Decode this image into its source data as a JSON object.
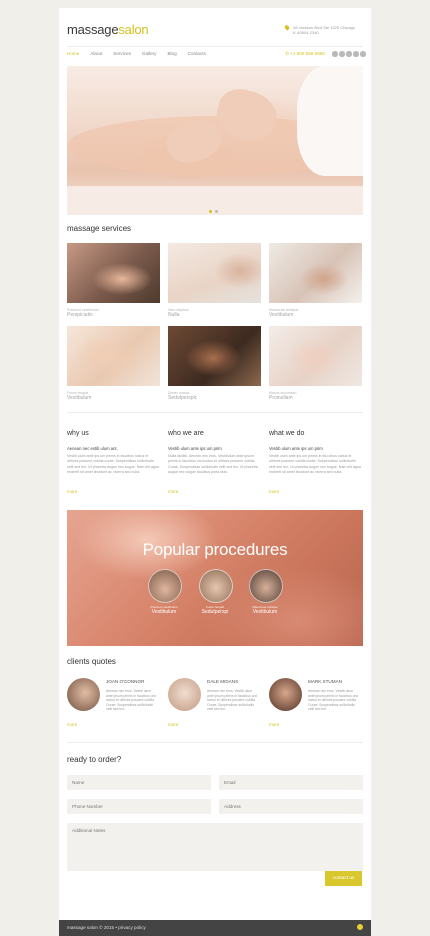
{
  "colors": {
    "accent": "#d4c21f",
    "text": "#333333",
    "muted": "#9a9a9a",
    "footer": "#444444"
  },
  "header": {
    "logo_part1": "massage",
    "logo_part2": "salon",
    "address_line1": "28 Jackson Blvd Ste 1020 Chicago",
    "address_line2": "IL 60604-2340",
    "phone": "+1 800 559 6580",
    "social_icons": [
      "facebook-icon",
      "twitter-icon",
      "google-plus-icon",
      "rss-icon",
      "pinterest-icon"
    ]
  },
  "nav": {
    "items": [
      "Home",
      "About",
      "Services",
      "Gallery",
      "Blog",
      "Contacts"
    ],
    "active": "Home"
  },
  "services": {
    "title": "massage services",
    "items": [
      {
        "caption": "Praesent vestibulum",
        "name": "Perspiciatis"
      },
      {
        "caption": "Nam dapibus",
        "name": "Nulla"
      },
      {
        "caption": "Maecenas tristique",
        "name": "Vestibulum"
      },
      {
        "caption": "Fusce feugiat",
        "name": "Vestibulum"
      },
      {
        "caption": "Donec massa",
        "name": "Sedutperspic"
      },
      {
        "caption": "Mauris accumsan",
        "name": "Proinullam"
      }
    ]
  },
  "columns": [
    {
      "title": "why us",
      "lead": "Aenean nec estib ulum ant.",
      "body": "Vestib ulum ante ips um primis in faucibus luctus et ultrices posuere cubilia curae; Suspendisse sollicitudin velit sed leo. Ut pharetra augue nec augue. Nam elit agna endrerit sit amet tincidunt ac viverra sed nulla.",
      "more": "more"
    },
    {
      "title": "who we are",
      "lead": "Vestib ulum ante ips um prim",
      "body": "Nulla facilisi. Aenean nec eros. Vestibulum ante ipsum primis in faucibus orci luctus et ultrices posuere cubilia Curae; Suspendisse sollicitudin velit sed leo. Ut pharetra augue nec augue faucibus porta duis.",
      "more": "more"
    },
    {
      "title": "what we do",
      "lead": "Vestib ulum ante ips um prim",
      "body": "Vestib ulum ante ips um primis in fau cibus luctus et ultrices posuere cubilia curae; Suspendisse sollicitudin velit sed leo. Ut pharetra augue nec augue. Nam elit agna endrerit sit amet tincidunt ac viverra sed nulla.",
      "more": "more"
    }
  ],
  "procedures": {
    "title": "Popular procedures",
    "items": [
      {
        "caption": "Praesent vestibulum",
        "name": "Vestibulum"
      },
      {
        "caption": "Fusce feugiat",
        "name": "Sedutperspi"
      },
      {
        "caption": "Maecenas tristique",
        "name": "Vestibulum"
      }
    ]
  },
  "quotes": {
    "title": "clients quotes",
    "items": [
      {
        "name": "JOAN O'CONNOR",
        "body": "Aenean nec eros. Vestib ulum ante ipsum primis in faucibus orci luctus et ultrices posuere cubilia Curae; Suspendisse sollicitudin velit sed leo.",
        "more": "more"
      },
      {
        "name": "DALE MIDANS",
        "body": "Aenean nec eros. Vestib ulum ante ipsum primis in faucibus orci luctus et ultrices posuere cubilia Curae; Suspendisse sollicitudin velit sed leo.",
        "more": "more"
      },
      {
        "name": "MARK STUMAN",
        "body": "Aenean nec eros. Vestib ulum ante ipsum primis in faucibus orci luctus et ultrices posuere cubilia Curae; Suspendisse sollicitudin velit sed leo.",
        "more": "more"
      }
    ]
  },
  "form": {
    "title": "ready to order?",
    "name_placeholder": "Name",
    "email_placeholder": "Email",
    "phone_placeholder": "Phone Number",
    "address_placeholder": "Address",
    "notes_placeholder": "Additional Notes",
    "submit_label": "contact us"
  },
  "footer": {
    "text": "massage salon © 2015 • privacy policy"
  }
}
